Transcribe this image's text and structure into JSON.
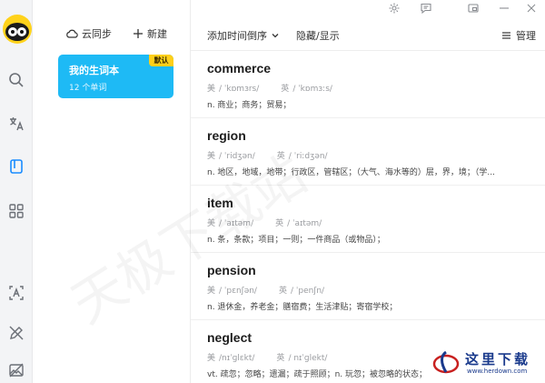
{
  "sidebar": {
    "icons": [
      "app-logo",
      "search-icon",
      "translate-icon",
      "wordbook-icon",
      "apps-grid-icon",
      "text-recognition-icon",
      "pen-icon",
      "image-off-icon"
    ]
  },
  "wordbooks": {
    "sync_label": "云同步",
    "new_label": "新建",
    "items": [
      {
        "title": "我的生词本",
        "count": "12 个单词",
        "badge": "默认"
      }
    ]
  },
  "toolbar": {
    "sort_label": "添加时间倒序",
    "toggle_label": "隐藏/显示",
    "manage_label": "管理"
  },
  "words": [
    {
      "word": "commerce",
      "us_label": "美",
      "us_ph": "/ ˈkɒmɜrs/",
      "uk_label": "英",
      "uk_ph": "/ ˈkɒmɜːs/",
      "def": "n. 商业；商务；贸易；"
    },
    {
      "word": "region",
      "us_label": "美",
      "us_ph": "/ ˈridʒən/",
      "uk_label": "英",
      "uk_ph": "/ ˈriːdʒən/",
      "def": "n. 地区，地域，地带；行政区，管辖区；（大气、海水等的）层，界，境；（学..."
    },
    {
      "word": "item",
      "us_label": "美",
      "us_ph": "/ ˈaɪtəm/",
      "uk_label": "英",
      "uk_ph": "/ ˈaɪtəm/",
      "def": "n. 条，条款；项目；一则；一件商品（或物品）；"
    },
    {
      "word": "pension",
      "us_label": "美",
      "us_ph": "/ ˈpɛnʃən/",
      "uk_label": "英",
      "uk_ph": "/ ˈpenʃn/",
      "def": "n. 退休金，养老金；膳宿费；生活津贴；寄宿学校；"
    },
    {
      "word": "neglect",
      "us_label": "美",
      "us_ph": "/nɪˈɡlɛkt/",
      "uk_label": "英",
      "uk_ph": "/ nɪˈɡlekt/",
      "def": "vt. 疏忽；忽略；遗漏；疏于照顾；n. 玩忽；被忽略的状态；"
    }
  ],
  "watermark": "天极下载站",
  "corner_logo": {
    "text": "这里下载",
    "url": "www.herdown.com"
  }
}
